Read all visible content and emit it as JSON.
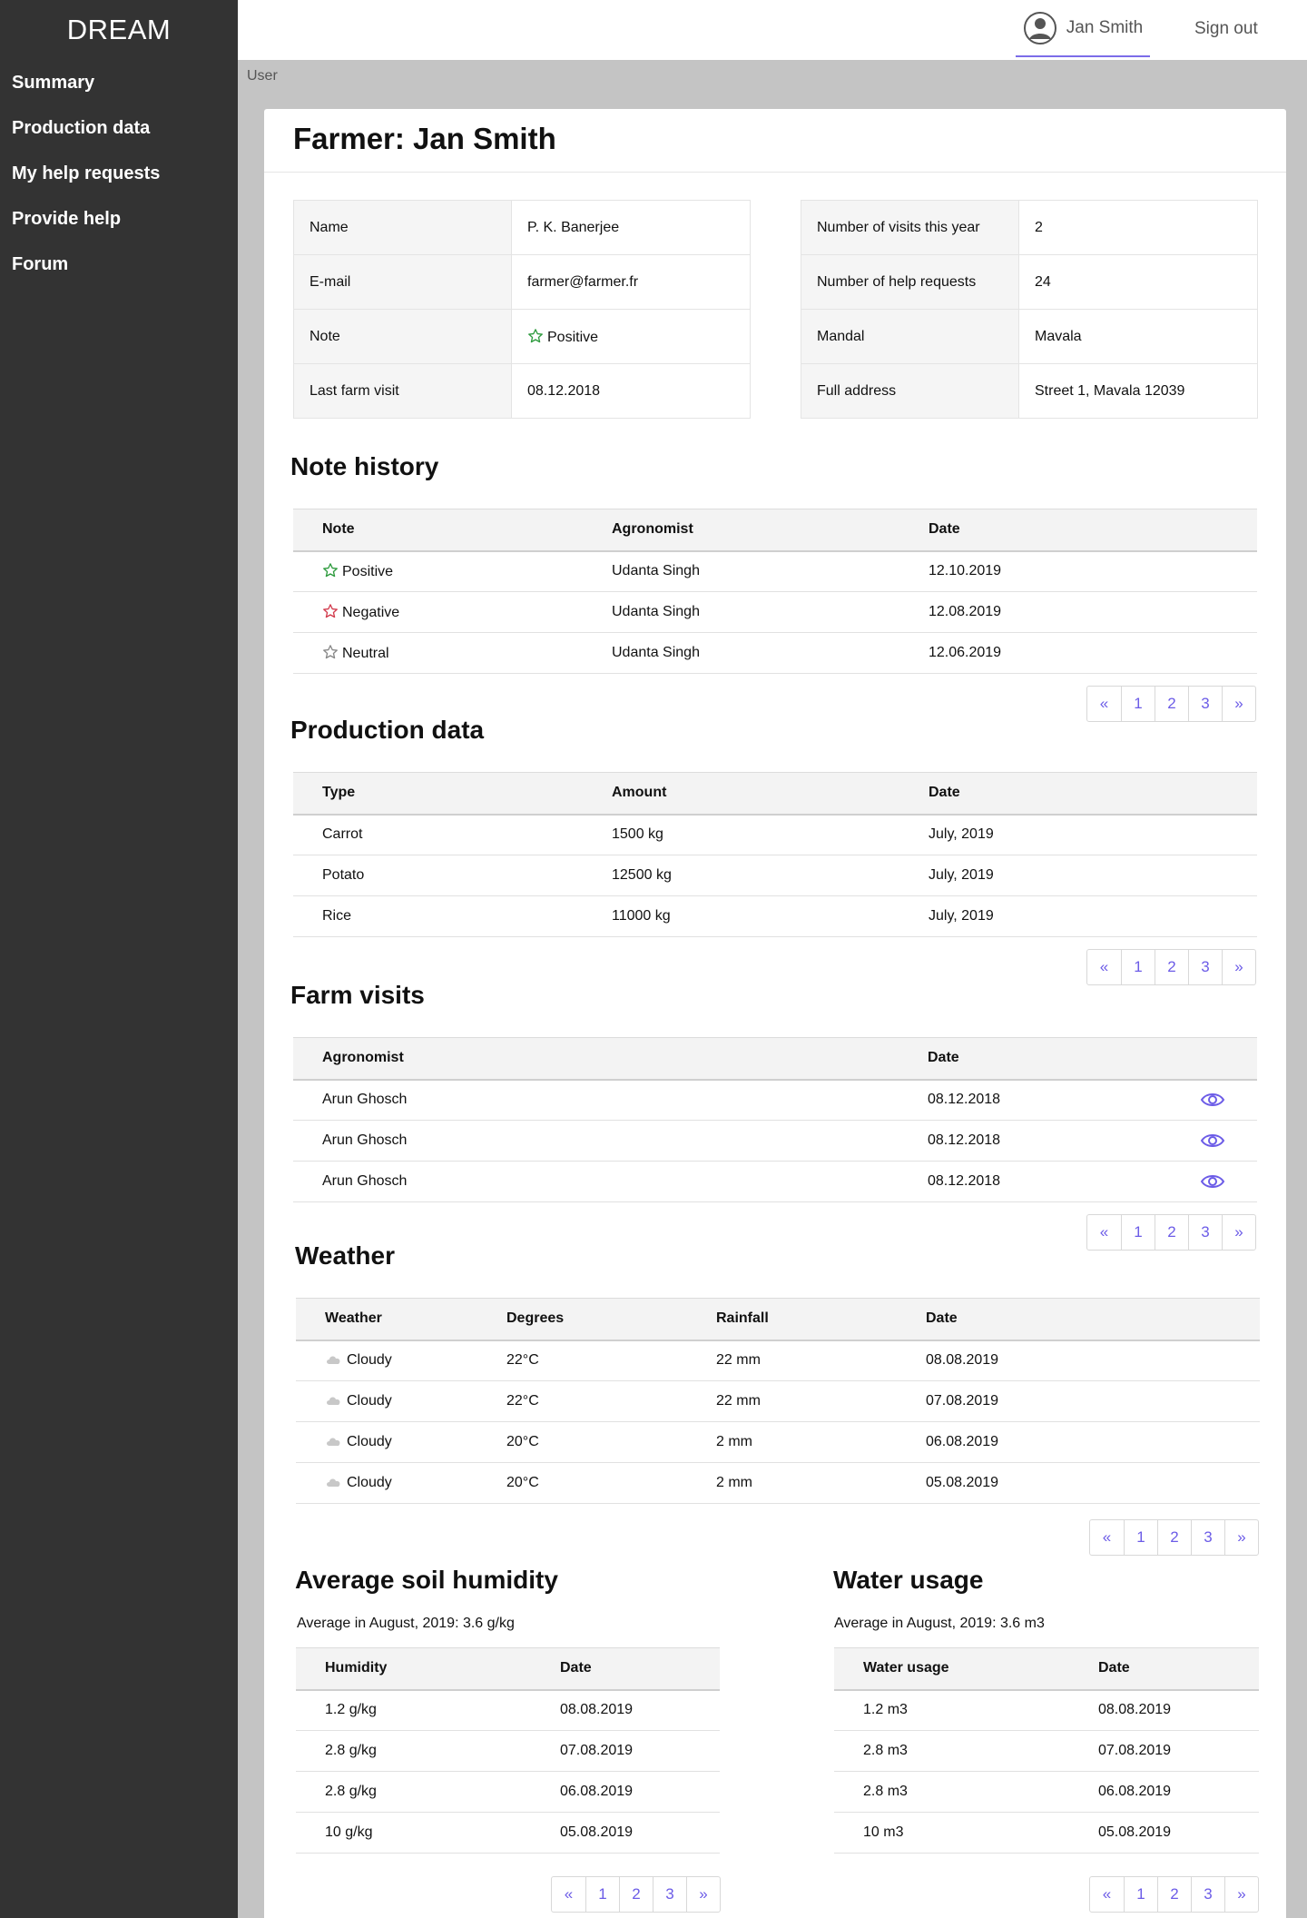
{
  "brand": "DREAM",
  "nav": [
    "Summary",
    "Production data",
    "My help requests",
    "Provide help",
    "Forum"
  ],
  "topbar": {
    "user_name": "Jan Smith",
    "signout": "Sign out"
  },
  "breadcrumb": "User",
  "page_title": "Farmer: Jan Smith",
  "info_left": [
    {
      "label": "Name",
      "value": "P. K. Banerjee"
    },
    {
      "label": "E-mail",
      "value": "farmer@farmer.fr"
    },
    {
      "label": "Note",
      "value": "Positive",
      "icon": "star-icon",
      "icon_color": "#2e9b3e"
    },
    {
      "label": "Last farm visit",
      "value": "08.12.2018"
    }
  ],
  "info_right": [
    {
      "label": "Number of visits this year",
      "value": "2"
    },
    {
      "label": "Number of help requests",
      "value": "24"
    },
    {
      "label": "Mandal",
      "value": "Mavala"
    },
    {
      "label": "Full address",
      "value": "Street 1, Mavala 12039"
    }
  ],
  "note_history": {
    "title": "Note history",
    "columns": [
      "Note",
      "Agronomist",
      "Date"
    ],
    "rows": [
      {
        "note": "Positive",
        "star_color": "#2e9b3e",
        "agronomist": "Udanta Singh",
        "date": "12.10.2019"
      },
      {
        "note": "Negative",
        "star_color": "#d23b4d",
        "agronomist": "Udanta Singh",
        "date": "12.08.2019"
      },
      {
        "note": "Neutral",
        "star_color": "#888888",
        "agronomist": "Udanta Singh",
        "date": "12.06.2019"
      }
    ]
  },
  "production": {
    "title": "Production data",
    "columns": [
      "Type",
      "Amount",
      "Date"
    ],
    "rows": [
      [
        "Carrot",
        "1500 kg",
        "July, 2019"
      ],
      [
        "Potato",
        "12500 kg",
        "July, 2019"
      ],
      [
        "Rice",
        "11000 kg",
        "July, 2019"
      ]
    ]
  },
  "visits": {
    "title": "Farm visits",
    "columns": [
      "Agronomist",
      "Date"
    ],
    "rows": [
      [
        "Arun Ghosch",
        "08.12.2018"
      ],
      [
        "Arun Ghosch",
        "08.12.2018"
      ],
      [
        "Arun Ghosch",
        "08.12.2018"
      ]
    ]
  },
  "weather": {
    "title": "Weather",
    "columns": [
      "Weather",
      "Degrees",
      "Rainfall",
      "Date"
    ],
    "rows": [
      [
        "Cloudy",
        "22°C",
        "22 mm",
        "08.08.2019"
      ],
      [
        "Cloudy",
        "22°C",
        "22 mm",
        "07.08.2019"
      ],
      [
        "Cloudy",
        "20°C",
        "2 mm",
        "06.08.2019"
      ],
      [
        "Cloudy",
        "20°C",
        "2 mm",
        "05.08.2019"
      ]
    ]
  },
  "humidity": {
    "title": "Average soil humidity",
    "average": "Average in August, 2019: 3.6 g/kg",
    "columns": [
      "Humidity",
      "Date"
    ],
    "rows": [
      [
        "1.2 g/kg",
        "08.08.2019"
      ],
      [
        "2.8 g/kg",
        "07.08.2019"
      ],
      [
        "2.8 g/kg",
        "06.08.2019"
      ],
      [
        "10 g/kg",
        "05.08.2019"
      ]
    ]
  },
  "water": {
    "title": "Water usage",
    "average": "Average in August, 2019: 3.6 m3",
    "columns": [
      "Water usage",
      "Date"
    ],
    "rows": [
      [
        "1.2 m3",
        "08.08.2019"
      ],
      [
        "2.8 m3",
        "07.08.2019"
      ],
      [
        "2.8 m3",
        "06.08.2019"
      ],
      [
        "10 m3",
        "05.08.2019"
      ]
    ]
  },
  "pager": [
    "«",
    "1",
    "2",
    "3",
    "»"
  ],
  "colors": {
    "accent": "#6c5ce7",
    "sidebar": "#333333",
    "background": "#c4c4c4"
  }
}
